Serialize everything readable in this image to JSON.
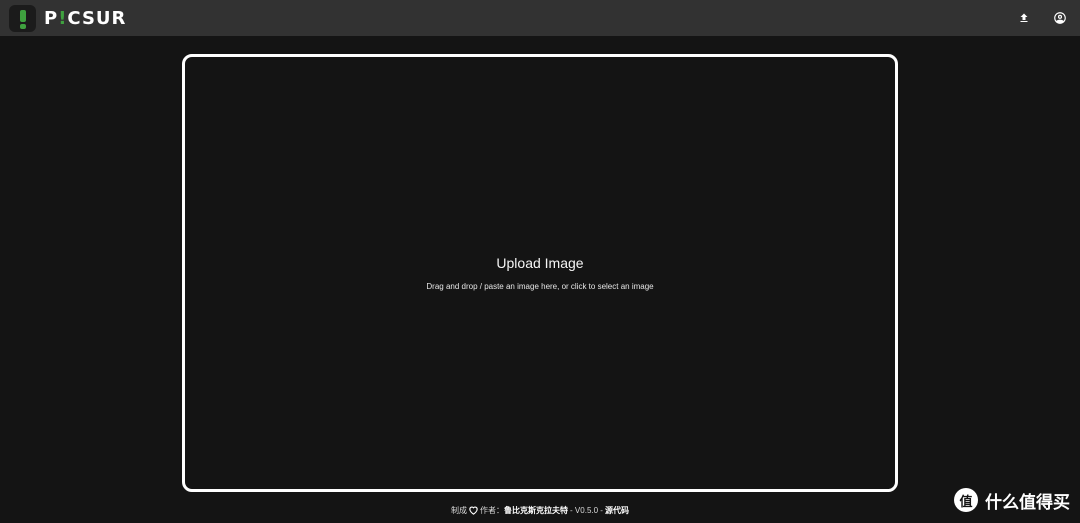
{
  "app": {
    "logo_text_pre": "P",
    "logo_text_accent": "!",
    "logo_text_post": "CSUR",
    "accent_color": "#3fa13f"
  },
  "toolbar": {
    "upload_icon": "upload-icon",
    "account_icon": "account-circle-icon"
  },
  "upload": {
    "title": "Upload Image",
    "subtitle": "Drag and drop / paste an image here, or click to select an image"
  },
  "footer": {
    "made_with": "制成",
    "heart_icon": "heart-icon",
    "author_label": "作者：",
    "author_name": "鲁比克斯克拉夫特",
    "version": "- V0.5.0 -",
    "source_link": "源代码"
  },
  "watermark": {
    "badge": "值",
    "text": "什么值得买"
  }
}
